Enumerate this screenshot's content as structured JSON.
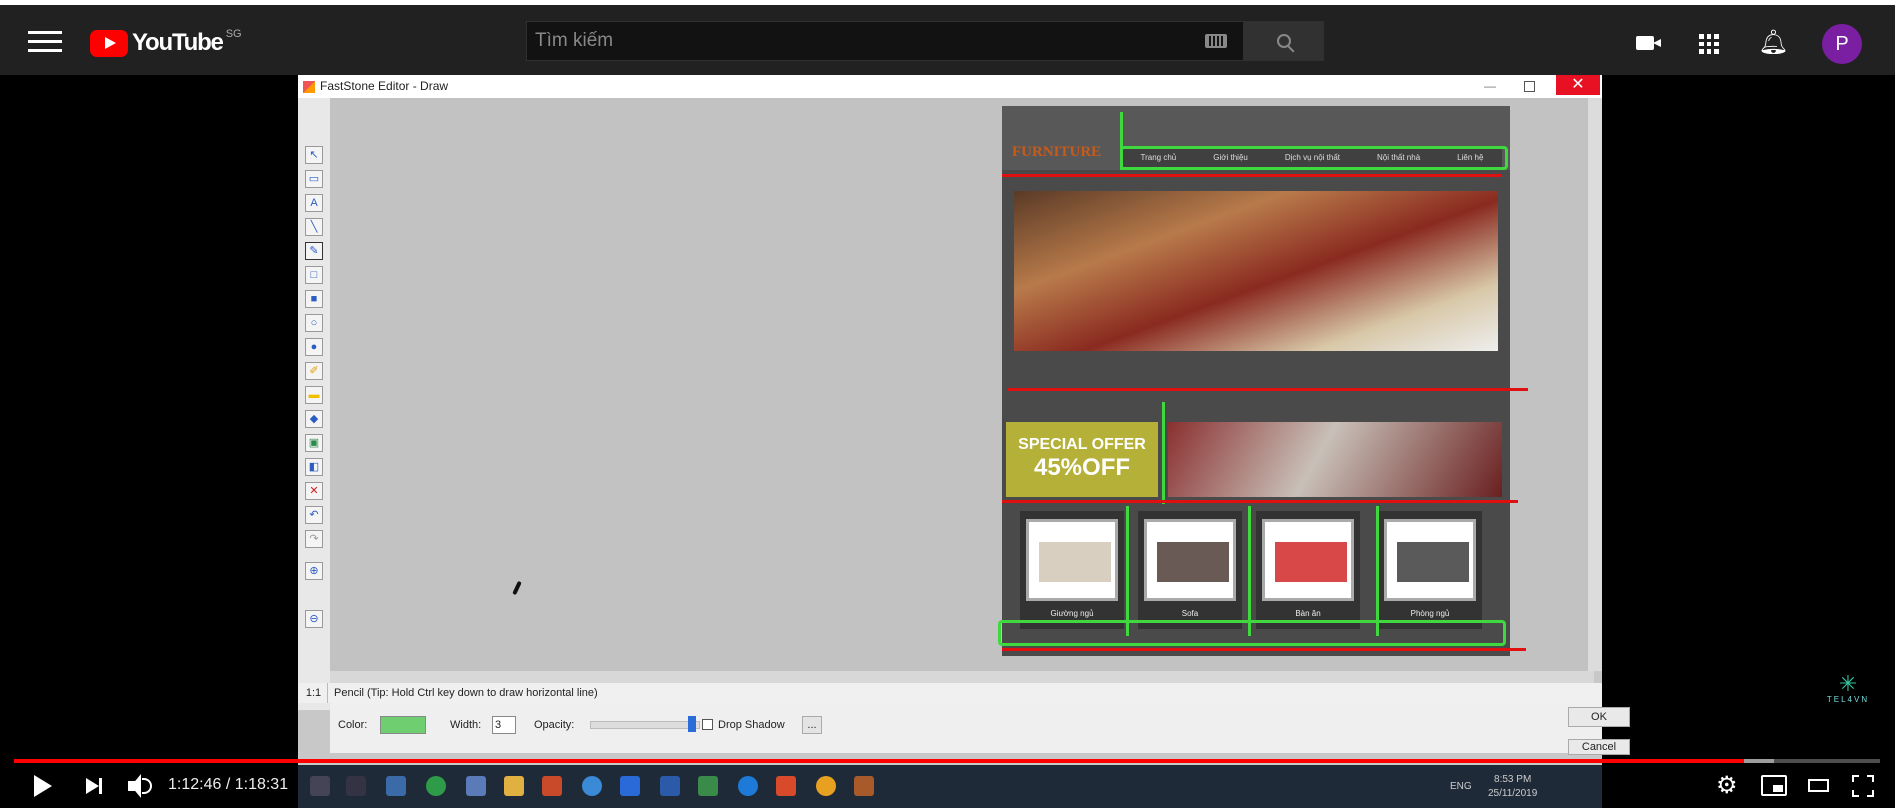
{
  "masthead": {
    "logo_text": "YouTube",
    "country_code": "SG",
    "search_placeholder": "Tìm kiếm",
    "avatar_letter": "P"
  },
  "editor": {
    "window_title": "FastStone Editor - Draw",
    "status_zoom": "1:1",
    "status_tip": "Pencil (Tip: Hold Ctrl key down to draw horizontal line)",
    "color_label": "Color:",
    "color_value": "#6fce6f",
    "width_label": "Width:",
    "width_value": "3",
    "opacity_label": "Opacity:",
    "opacity_level": 0.95,
    "drop_shadow_label": "Drop Shadow",
    "more_button": "...",
    "ok_label": "OK",
    "cancel_label": "Cancel"
  },
  "website": {
    "logo": "FURNITURE",
    "nav": [
      "Trang chủ",
      "Giới thiệu",
      "Dịch vụ nội thất",
      "Nội thất nhà",
      "Liên hệ"
    ],
    "offer_line1": "SPECIAL OFFER",
    "offer_line2": "45%OFF",
    "products": [
      "Giường ngủ",
      "Sofa",
      "Bàn ăn",
      "Phòng ngủ"
    ]
  },
  "taskbar": {
    "language": "ENG",
    "time": "8:53 PM",
    "date": "25/11/2019"
  },
  "player": {
    "current_time": "1:12:46",
    "duration": "1:18:31",
    "timecode": "1:12:46 / 1:18:31",
    "progress": 0.927,
    "watermark": "TEL4VN"
  },
  "colors": {
    "youtube_red": "#ff0000",
    "masthead_bg": "#212121",
    "avatar_bg": "#7b1fa2",
    "annotation_green": "#3fd83f",
    "annotation_red": "#e01010"
  }
}
